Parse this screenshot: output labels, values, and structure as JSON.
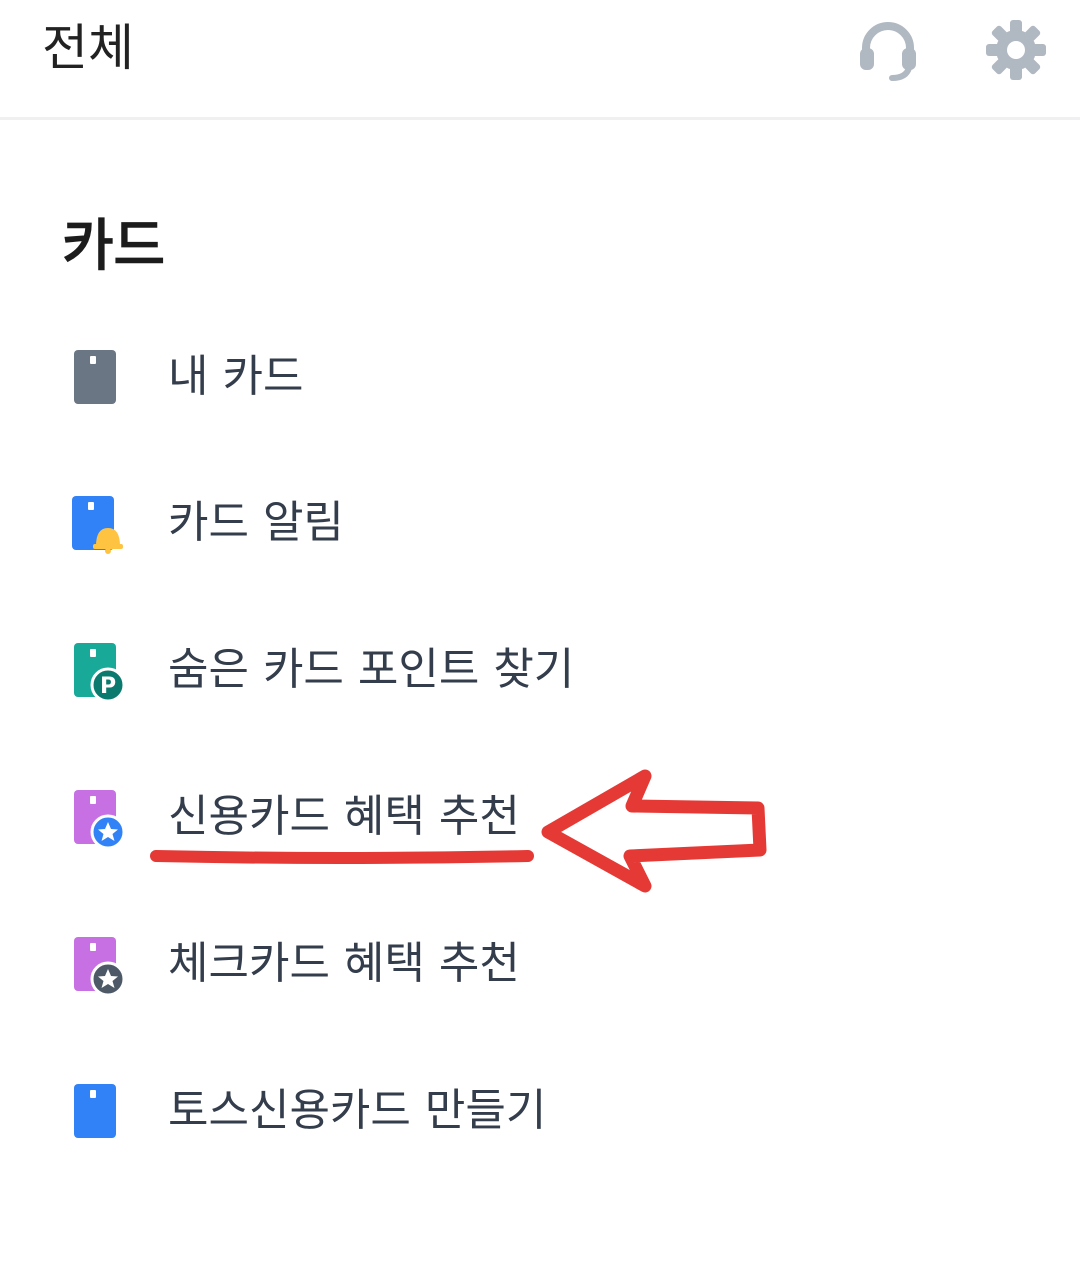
{
  "header": {
    "title": "전체",
    "support_icon": "headset-icon",
    "settings_icon": "gear-icon"
  },
  "section": {
    "title": "카드"
  },
  "menu": [
    {
      "label": "내 카드",
      "icon": "card-icon",
      "color": "#6b7684"
    },
    {
      "label": "카드 알림",
      "icon": "card-bell-icon",
      "color": "#3182f6",
      "badge_color": "#ffc342"
    },
    {
      "label": "숨은 카드 포인트 찾기",
      "icon": "card-point-icon",
      "color": "#18a999",
      "badge_color": "#0b7a6e",
      "badge_text": "P"
    },
    {
      "label": "신용카드 혜택 추천",
      "icon": "card-star-icon",
      "color": "#c770e4",
      "badge_color": "#3182f6"
    },
    {
      "label": "체크카드 혜택 추천",
      "icon": "card-star-icon",
      "color": "#c770e4",
      "badge_color": "#4e5968"
    },
    {
      "label": "토스신용카드 만들기",
      "icon": "card-icon",
      "color": "#3182f6"
    }
  ],
  "colors": {
    "annotation": "#e53935",
    "header_icons": "#b0b8c1"
  }
}
